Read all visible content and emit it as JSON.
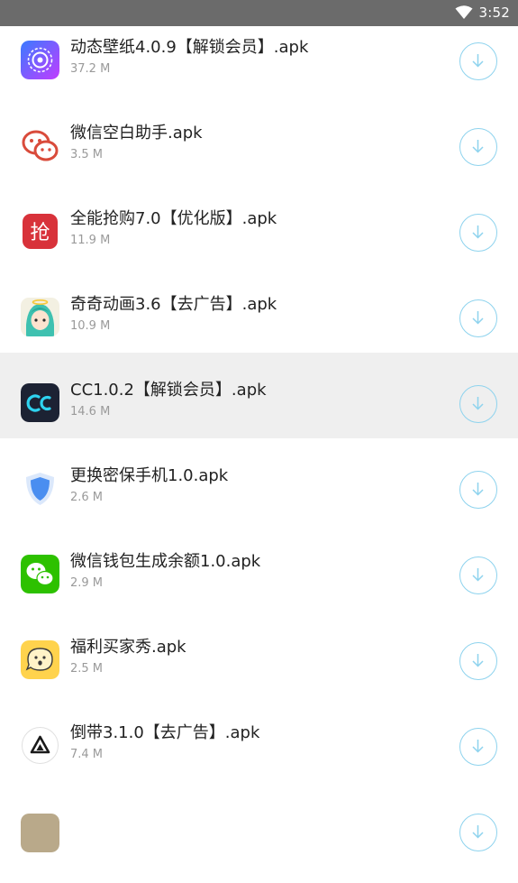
{
  "status_bar": {
    "time": "3:52",
    "wifi_icon": "wifi-icon"
  },
  "colors": {
    "status_bar_bg": "#6b6b6b",
    "download_accent": "#8ed3ee",
    "highlight_row": "#efefef",
    "size_text": "#9a9a9a"
  },
  "items": [
    {
      "name": "动态壁纸4.0.9【解锁会员】.apk",
      "size": "37.2 M",
      "icon": "dynamic-wallpaper-icon"
    },
    {
      "name": "微信空白助手.apk",
      "size": "3.5 M",
      "icon": "wechat-blank-helper-icon"
    },
    {
      "name": "全能抢购7.0【优化版】.apk",
      "size": "11.9 M",
      "icon": "qiang-icon"
    },
    {
      "name": "奇奇动画3.6【去广告】.apk",
      "size": "10.9 M",
      "icon": "anime-icon"
    },
    {
      "name": "CC1.0.2【解锁会员】.apk",
      "size": "14.6 M",
      "icon": "cc-icon"
    },
    {
      "name": "更换密保手机1.0.apk",
      "size": "2.6 M",
      "icon": "shield-icon"
    },
    {
      "name": "微信钱包生成余额1.0.apk",
      "size": "2.9 M",
      "icon": "wechat-icon"
    },
    {
      "name": "福利买家秀.apk",
      "size": "2.5 M",
      "icon": "smiley-icon"
    },
    {
      "name": "倒带3.1.0【去广告】.apk",
      "size": "7.4 M",
      "icon": "rewind-icon"
    }
  ]
}
